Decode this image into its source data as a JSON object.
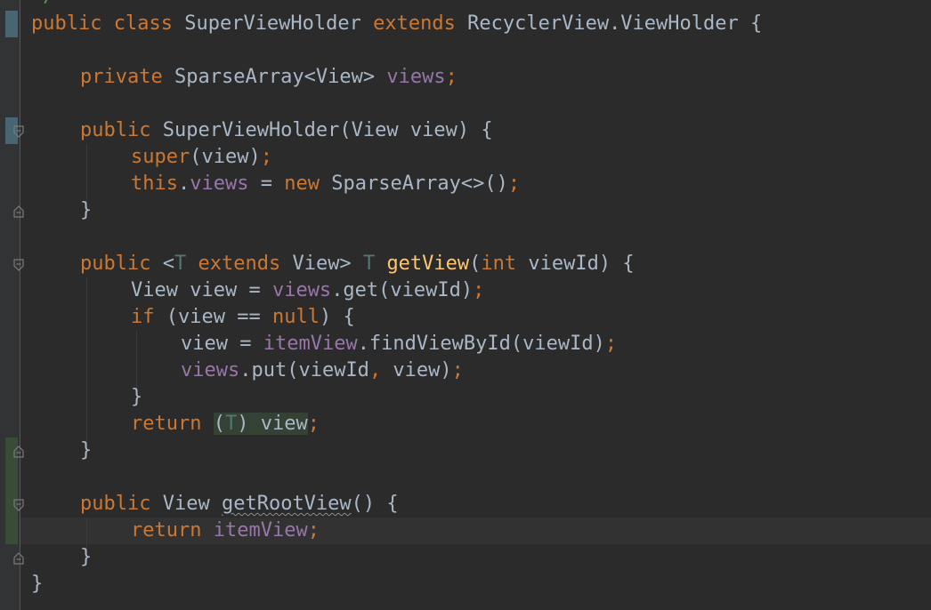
{
  "editor": {
    "colors": {
      "background": "#2b2b2b",
      "gutter": "#313335",
      "keyword": "#cc7832",
      "method": "#ffc66d",
      "field": "#9876aa",
      "type_param": "#507874",
      "text": "#a9b7c6",
      "vcs_modified": "#4a6572",
      "vcs_added": "#384c38"
    },
    "top_partial": "*/",
    "code": {
      "l1": {
        "kw1": "public",
        "kw2": "class",
        "name": "SuperViewHolder",
        "kw3": "extends",
        "parent": "RecyclerView.ViewHolder",
        "brace": "{"
      },
      "l2": {
        "kw": "private",
        "type": "SparseArray<View>",
        "field": "views",
        "semi": ";"
      },
      "l3": {
        "kw": "public",
        "name": "SuperViewHolder(View view)",
        "brace": "{"
      },
      "l4": {
        "kw": "super",
        "args": "(view)",
        "semi": ";"
      },
      "l5": {
        "kw_this": "this",
        "dot": ".",
        "field": "views",
        "eq": " = ",
        "kw_new": "new",
        "rest": "SparseArray<>()",
        "semi": ";"
      },
      "l6": {
        "brace": "}"
      },
      "l7": {
        "kw": "public",
        "lt": "<",
        "tp1": "T",
        "kw2": "extends",
        "mid": "View>",
        "tp2": "T",
        "method": "getView",
        "open": "(",
        "kw_int": "int",
        "rest": "viewId)",
        "brace": "{"
      },
      "l8": {
        "pre": "View view = ",
        "field": "views",
        "rest": ".get(viewId)",
        "semi": ";"
      },
      "l9": {
        "kw": "if",
        "open": "(view == ",
        "kw_null": "null",
        "close": ")",
        "brace": "{"
      },
      "l10": {
        "pre": "view = ",
        "field": "itemView",
        "rest": ".findViewById(viewId)",
        "semi": ";"
      },
      "l11": {
        "field": "views",
        "rest1": ".put(viewId",
        "comma": ",",
        "rest2": " view)",
        "semi": ";"
      },
      "l12": {
        "brace": "}"
      },
      "l13": {
        "kw": "return",
        "open": "(",
        "tp": "T",
        "close": ")",
        "rest": " view",
        "semi": ";"
      },
      "l14": {
        "brace": "}"
      },
      "l15": {
        "kw": "public",
        "type": "View",
        "method": "getRootView",
        "rest": "()",
        "brace": "{"
      },
      "l16": {
        "kw": "return",
        "field": "itemView",
        "semi": ";"
      },
      "l17": {
        "brace": "}"
      },
      "l18": {
        "brace": "}"
      }
    }
  }
}
